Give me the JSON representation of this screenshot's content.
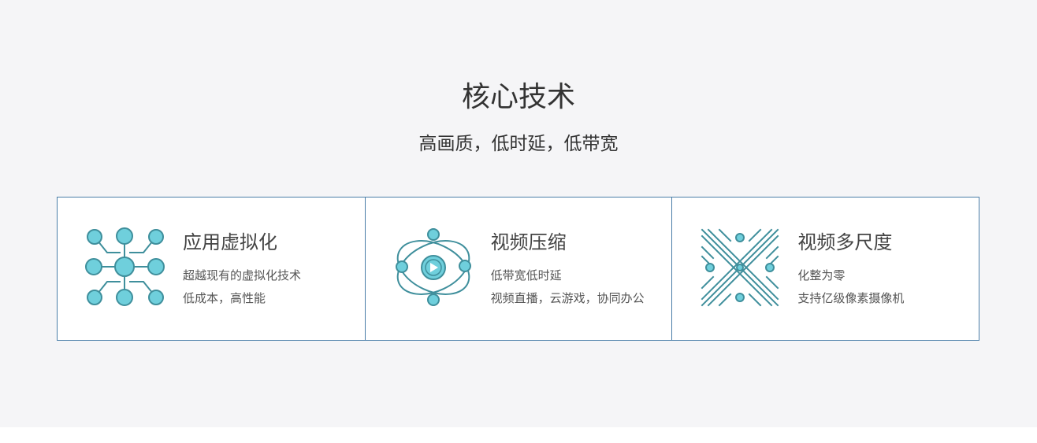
{
  "section": {
    "title": "核心技术",
    "subtitle": "高画质，低时延，低带宽"
  },
  "cards": [
    {
      "icon": "network-nodes-icon",
      "title": "应用虚拟化",
      "lines": [
        "超越现有的虚拟化技术",
        "低成本，高性能"
      ]
    },
    {
      "icon": "video-orbit-icon",
      "title": "视频压缩",
      "lines": [
        "低带宽低时延",
        "视频直播，云游戏，协同办公"
      ]
    },
    {
      "icon": "crossed-lines-icon",
      "title": "视频多尺度",
      "lines": [
        "化整为零",
        "支持亿级像素摄像机"
      ]
    }
  ],
  "colors": {
    "background": "#f5f5f7",
    "card_border": "#4a7ea8",
    "icon_fill": "#6fcfdc",
    "icon_stroke": "#3f8f9c"
  }
}
